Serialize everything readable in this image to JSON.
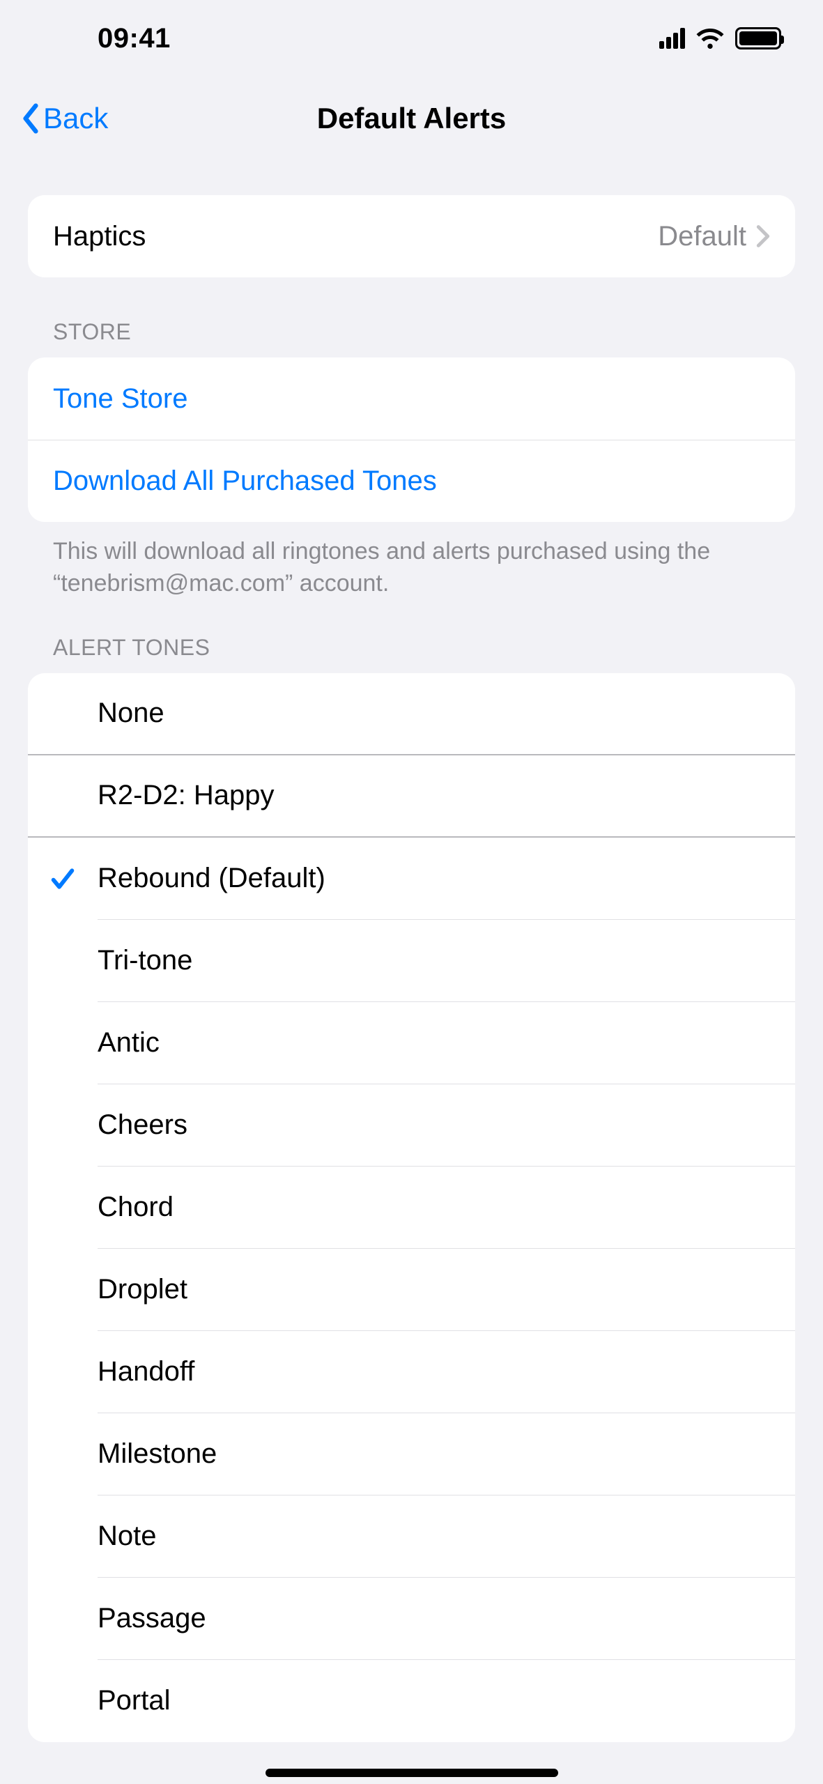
{
  "status": {
    "time": "09:41"
  },
  "nav": {
    "back": "Back",
    "title": "Default Alerts"
  },
  "haptics": {
    "label": "Haptics",
    "value": "Default"
  },
  "store": {
    "header": "STORE",
    "tone_store": "Tone Store",
    "download_all": "Download All Purchased Tones",
    "footer": "This will download all ringtones and alerts purchased using the “tenebrism@mac.com” account."
  },
  "tones": {
    "header": "ALERT TONES",
    "selected_index": 2,
    "items": [
      "None",
      "R2-D2: Happy",
      "Rebound (Default)",
      "Tri-tone",
      "Antic",
      "Cheers",
      "Chord",
      "Droplet",
      "Handoff",
      "Milestone",
      "Note",
      "Passage",
      "Portal"
    ]
  }
}
